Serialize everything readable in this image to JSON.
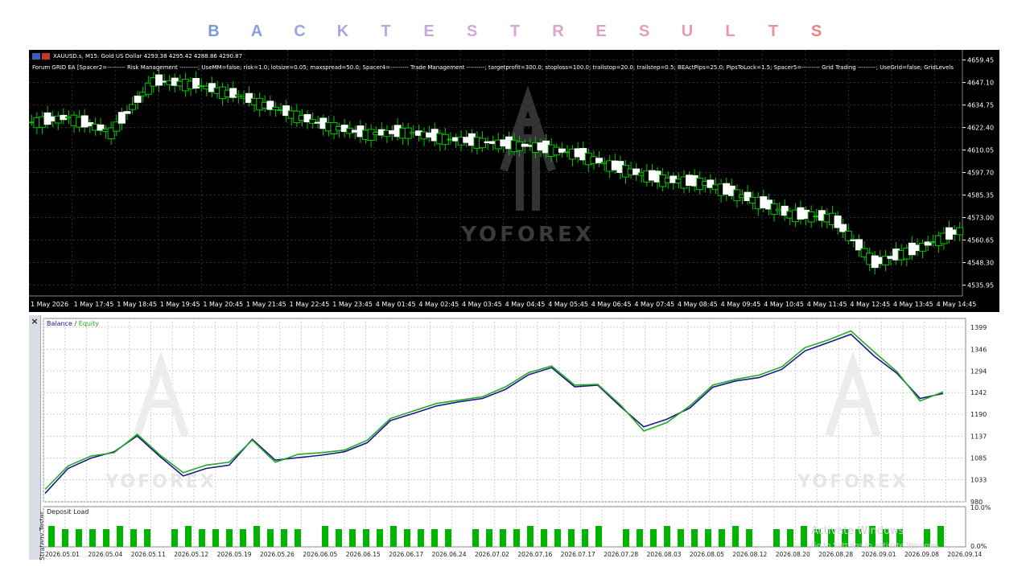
{
  "banner": {
    "letters": [
      "B",
      "A",
      "C",
      "K",
      "T",
      "E",
      "S",
      "T",
      "R",
      "E",
      "S",
      "U",
      "L",
      "T",
      "S"
    ],
    "colors": [
      "#7a9ad4",
      "#8a9fd8",
      "#9aa4dc",
      "#aaa6dc",
      "#b8a8dc",
      "#c4aadc",
      "#d0aadc",
      "#d6a6d6",
      "#dca4cc",
      "#e0a2c2",
      "#e2a0b8",
      "#e49eae",
      "#e69ca4",
      "#ea9098",
      "#ee8088"
    ]
  },
  "mt4": {
    "symbol_title": "XAUUSD.s, M15: Gold US Dollar  4293.38 4295.42 4288.86 4290.87",
    "params_line": "Forum GRID EA [Spacer2=--------- Risk Management ---------; UseMM=false; risk=1.0; lotsize=0.05; maxspread=50.0; Spacer4=--------- Trade Management ---------; targetprofit=300.0; stoploss=100.0; trailstop=20.0; trailstep=0.5; BEActPips=25.0; PipsToLock=1.5; Spacer5=--------- Grid Trading ---------; UseGrid=false; GridLevels",
    "watermark": "YOFOREX",
    "price_labels": [
      "4659.45",
      "4647.10",
      "4634.75",
      "4622.40",
      "4610.05",
      "4597.70",
      "4585.35",
      "4573.00",
      "4560.65",
      "4548.30",
      "4535.95"
    ],
    "time_labels": [
      "1 May 2026",
      "1 May 17:45",
      "1 May 18:45",
      "1 May 19:45",
      "1 May 20:45",
      "1 May 21:45",
      "1 May 22:45",
      "1 May 23:45",
      "4 May 01:45",
      "4 May 02:45",
      "4 May 03:45",
      "4 May 04:45",
      "4 May 05:45",
      "4 May 06:45",
      "4 May 07:45",
      "4 May 08:45",
      "4 May 09:45",
      "4 May 10:45",
      "4 May 11:45",
      "4 May 12:45",
      "4 May 13:45",
      "4 May 14:45"
    ],
    "colors": {
      "bull": "#ffffff",
      "bear": "#ffffff",
      "wick": "#00c800",
      "grid": "#2f2f2f",
      "text": "#ffffff"
    }
  },
  "tester": {
    "side_label": "Strategy Tester",
    "close_icon": "×",
    "legend_balance": "Balance",
    "legend_sep": " / ",
    "legend_equity": "Equity",
    "balance_y_labels": [
      "1399",
      "1346",
      "1294",
      "1242",
      "1190",
      "1137",
      "1085",
      "1033",
      "980"
    ],
    "deposit_title": "Deposit Load",
    "deposit_y_labels": [
      "10.0%",
      "0.0%"
    ],
    "date_labels": [
      "2026.05.01",
      "2026.05.04",
      "2026.05.11",
      "2026.05.12",
      "2026.05.19",
      "2026.05.26",
      "2026.06.05",
      "2026.06.15",
      "2026.06.17",
      "2026.06.24",
      "2026.07.02",
      "2026.07.16",
      "2026.07.17",
      "2026.07.28",
      "2026.08.03",
      "2026.08.05",
      "2026.08.12",
      "2026.08.20",
      "2026.08.28",
      "2026.09.01",
      "2026.09.08",
      "2026.09.14"
    ],
    "activate_line1": "Activate Windows",
    "activate_line2": "Go to Settings to activate Windows.",
    "watermark": "YOFOREX",
    "colors": {
      "balance": "#1a1a8c",
      "equity": "#22aa22",
      "deposit": "#00b400",
      "grid": "#cfcfcf"
    }
  },
  "chart_data": [
    {
      "type": "candlestick",
      "title": "XAUUSD.s, M15",
      "ylim": [
        4530,
        4665
      ],
      "x": [
        "1 May 2026",
        "1 May 17:45",
        "1 May 18:45",
        "1 May 19:45",
        "1 May 20:45",
        "1 May 21:45",
        "1 May 22:45",
        "1 May 23:45",
        "4 May 01:45",
        "4 May 02:45",
        "4 May 03:45",
        "4 May 04:45",
        "4 May 05:45",
        "4 May 06:45",
        "4 May 07:45",
        "4 May 08:45",
        "4 May 09:45",
        "4 May 10:45",
        "4 May 11:45",
        "4 May 12:45",
        "4 May 13:45",
        "4 May 14:45"
      ],
      "close": [
        4628,
        4620,
        4648,
        4646,
        4640,
        4632,
        4624,
        4619,
        4620,
        4616,
        4614,
        4612,
        4608,
        4600,
        4594,
        4592,
        4584,
        4575,
        4573,
        4548,
        4556,
        4566
      ]
    },
    {
      "type": "line",
      "series": [
        {
          "name": "Balance",
          "values": [
            1000,
            1060,
            1085,
            1100,
            1138,
            1088,
            1042,
            1060,
            1068,
            1130,
            1080,
            1086,
            1092,
            1100,
            1122,
            1175,
            1192,
            1210,
            1220,
            1228,
            1250,
            1285,
            1302,
            1256,
            1260,
            1208,
            1160,
            1178,
            1205,
            1255,
            1270,
            1278,
            1298,
            1342,
            1362,
            1382,
            1330,
            1288,
            1228,
            1240
          ]
        },
        {
          "name": "Equity",
          "values": [
            1010,
            1066,
            1090,
            1098,
            1142,
            1092,
            1050,
            1068,
            1075,
            1128,
            1075,
            1094,
            1098,
            1104,
            1128,
            1180,
            1198,
            1216,
            1224,
            1232,
            1256,
            1290,
            1306,
            1260,
            1262,
            1212,
            1150,
            1170,
            1210,
            1260,
            1274,
            1284,
            1304,
            1350,
            1368,
            1390,
            1340,
            1292,
            1222,
            1244
          ]
        }
      ],
      "ylim": [
        980,
        1420
      ]
    },
    {
      "type": "bar",
      "title": "Deposit Load",
      "ylim": [
        0,
        10
      ]
    }
  ]
}
